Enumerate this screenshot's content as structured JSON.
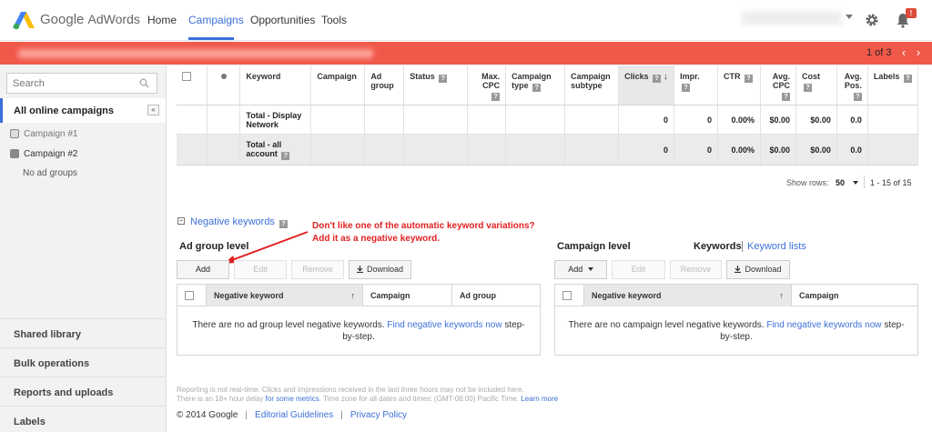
{
  "app": {
    "logo_google": "Google",
    "logo_product": "AdWords"
  },
  "nav": {
    "items": [
      "Home",
      "Campaigns",
      "Opportunities",
      "Tools"
    ],
    "active": "Campaigns"
  },
  "header": {
    "notification_count": "!"
  },
  "alert": {
    "pager_text": "1 of 3",
    "prev_icon": "chevron-left",
    "next_icon": "chevron-right"
  },
  "sidebar": {
    "search_placeholder": "Search",
    "all_campaigns": "All online campaigns",
    "campaigns": [
      "Campaign #1",
      "Campaign #2"
    ],
    "no_ad_groups": "No ad groups",
    "links": [
      "Shared library",
      "Bulk operations",
      "Reports and uploads",
      "Labels"
    ]
  },
  "table": {
    "headers": {
      "keyword": "Keyword",
      "campaign": "Campaign",
      "ad_group": "Ad group",
      "status": "Status",
      "max_cpc": "Max. CPC",
      "campaign_type": "Campaign type",
      "campaign_subtype": "Campaign subtype",
      "clicks": "Clicks",
      "impr": "Impr.",
      "ctr": "CTR",
      "avg_cpc": "Avg. CPC",
      "cost": "Cost",
      "avg_pos": "Avg. Pos.",
      "labels": "Labels"
    },
    "rows": [
      {
        "label": "Total - Display Network",
        "clicks": "0",
        "impr": "0",
        "ctr": "0.00%",
        "avg_cpc": "$0.00",
        "cost": "$0.00",
        "avg_pos": "0.0"
      },
      {
        "label": "Total - all account",
        "clicks": "0",
        "impr": "0",
        "ctr": "0.00%",
        "avg_cpc": "$0.00",
        "cost": "$0.00",
        "avg_pos": "0.0"
      }
    ],
    "show_rows_label": "Show rows:",
    "show_rows_value": "50",
    "range": "1 - 15 of 15"
  },
  "negative": {
    "title": "Negative keywords",
    "annotation_line1": "Don't like one of the automatic keyword variations?",
    "annotation_line2": "Add it as a negative keyword.",
    "ad_group_level": "Ad group level",
    "campaign_level": "Campaign level",
    "keywords_tab": "Keywords",
    "keyword_lists_tab": "Keyword lists",
    "buttons": {
      "add": "Add",
      "edit": "Edit",
      "remove": "Remove",
      "download": "Download"
    },
    "adgroup_headers": [
      "Negative keyword",
      "Campaign",
      "Ad group"
    ],
    "campaign_headers": [
      "Negative keyword",
      "Campaign"
    ],
    "adgroup_empty_pre": "There are no ad group level negative keywords.",
    "adgroup_empty_link": "Find negative keywords now",
    "adgroup_empty_post": "step-by-step.",
    "campaign_empty_pre": "There are no campaign level negative keywords.",
    "campaign_empty_link": "Find negative keywords now",
    "campaign_empty_post": "step-by-step."
  },
  "footer": {
    "note_line1": "Reporting is not real-time. Clicks and impressions received in the last three hours may not be included here.",
    "note_line2_pre": "There is an 18+ hour delay",
    "note_line2_link": "for some metrics",
    "note_line2_post": ". Time zone for all dates and times: (GMT-08:00) Pacific Time.",
    "note_learn_more": "Learn more",
    "copyright": "© 2014 Google",
    "links": [
      "Editorial Guidelines",
      "Privacy Policy"
    ]
  },
  "colors": {
    "accent": "#3b6fd8",
    "alert_bar": "#f0584a",
    "annotation": "#e02222"
  }
}
